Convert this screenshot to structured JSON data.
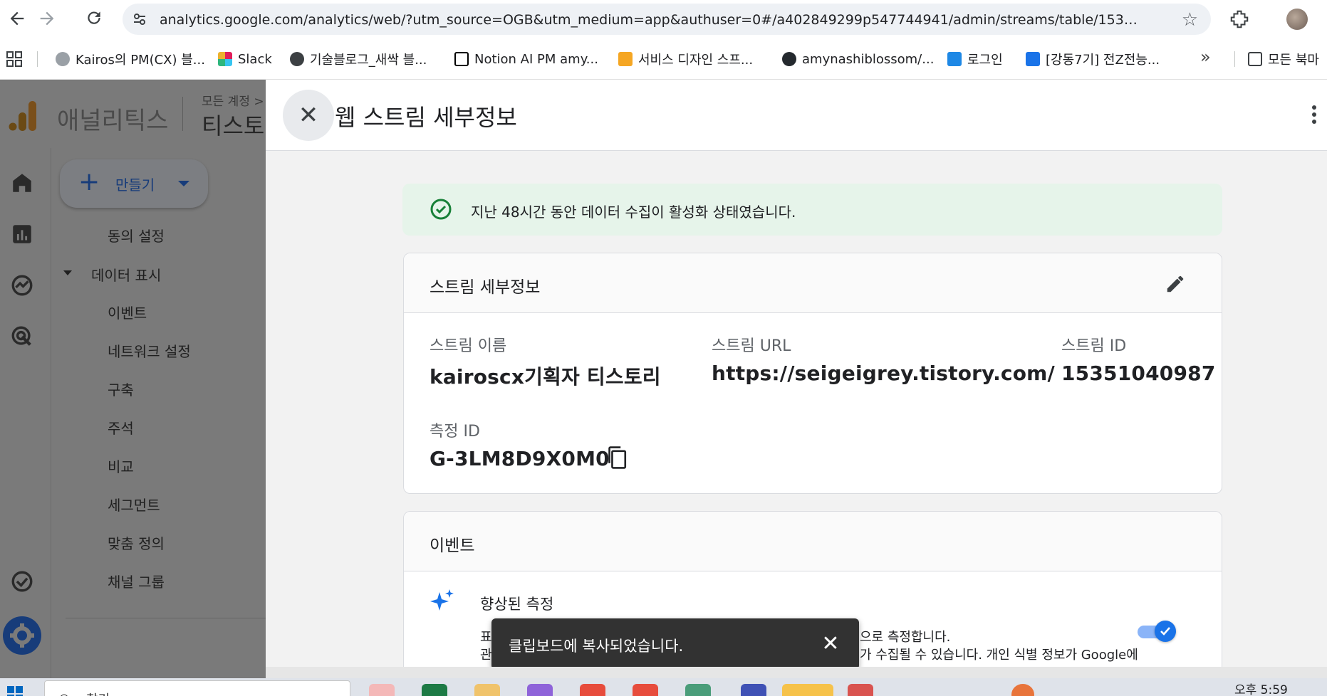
{
  "browser": {
    "url": "analytics.google.com/analytics/web/?utm_source=OGB&utm_medium=app&authuser=0#/a402849299p547744941/admin/streams/table/1535104...",
    "bookmarks": [
      {
        "label": "Kairos의 PM(CX) 블...",
        "icon": "kairos-icon",
        "color": "#9aa0a6"
      },
      {
        "label": "Slack",
        "icon": "slack-icon",
        "color": "#e01e5a"
      },
      {
        "label": "기술블로그_새싹 블...",
        "icon": "globe-icon",
        "color": "#3c4043"
      },
      {
        "label": "Notion AI PM amy...",
        "icon": "notion-icon",
        "color": "#000000"
      },
      {
        "label": "서비스 디자인 스프...",
        "icon": "runner-icon",
        "color": "#f5a623"
      },
      {
        "label": "amynashiblossom/...",
        "icon": "github-icon",
        "color": "#24292e"
      },
      {
        "label": "로그인",
        "icon": "sba-icon",
        "color": "#1e88e5"
      },
      {
        "label": "[강동7기] 전Z전능...",
        "icon": "laptop-icon",
        "color": "#1a73e8"
      }
    ],
    "bookmark_folder": "모든 북마"
  },
  "ga": {
    "product": "애널리틱스",
    "account_small": "모든 계정 >",
    "account_big": "티스토리",
    "create_label": "만들기",
    "nav": {
      "consent": "동의 설정",
      "data_display": "데이터 표시",
      "events": "이벤트",
      "network": "네트워크 설정",
      "build": "구축",
      "annotations": "주석",
      "compare": "비교",
      "segments": "세그먼트",
      "custom": "맞춤 정의",
      "channel_group": "채널 그룹"
    }
  },
  "panel": {
    "title": "웹 스트림 세부정보",
    "alert": "지난 48시간 동안 데이터 수집이 활성화 상태였습니다.",
    "stream_card": {
      "title": "스트림 세부정보",
      "name_label": "스트림 이름",
      "name_value": "kairoscx기획자 티스토리",
      "url_label": "스트림 URL",
      "url_value": "https://seigeigrey.tistory.com/",
      "id_label": "스트림 ID",
      "id_value": "15351040987",
      "measurement_label": "측정 ID",
      "measurement_value": "G-3LM8D9X0M0"
    },
    "events_card": {
      "title": "이벤트",
      "enhanced_title": "향상된 측정",
      "line1_left": "표",
      "line1_right": "으로 측정합니다.",
      "line2_left": "관",
      "line2_right": "가 수집될 수 있습니다. 개인 식별 정보가 Google에",
      "toggle_on": true
    }
  },
  "snackbar": {
    "message": "클립보드에 복사되었습니다."
  },
  "taskbar": {
    "search_text": "찾기",
    "time": "오후 5:59"
  },
  "colors": {
    "accent": "#1a73e8",
    "success": "#188038",
    "alert_bg": "#e6f4ea",
    "scrim": "#7a7a7a"
  }
}
